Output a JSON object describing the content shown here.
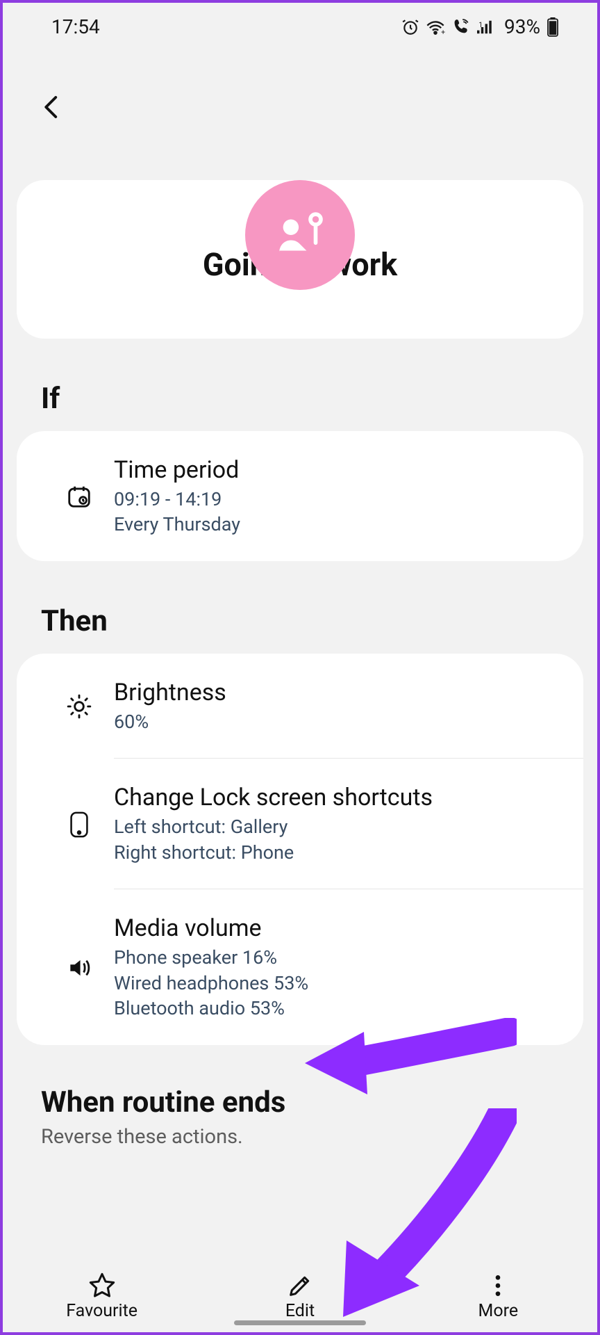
{
  "status": {
    "time": "17:54",
    "battery_text": "93%"
  },
  "routine": {
    "title": "Going to work"
  },
  "sections": {
    "if": {
      "header": "If",
      "time_period": {
        "title": "Time period",
        "range": "09:19 - 14:19",
        "repeat": "Every Thursday"
      }
    },
    "then": {
      "header": "Then",
      "brightness": {
        "title": "Brightness",
        "value": "60%"
      },
      "lock_shortcuts": {
        "title": "Change Lock screen shortcuts",
        "left": "Left shortcut: Gallery",
        "right": "Right shortcut: Phone"
      },
      "media_volume": {
        "title": "Media volume",
        "line1": "Phone speaker 16%",
        "line2": "Wired headphones 53%",
        "line3": "Bluetooth audio 53%"
      }
    },
    "end": {
      "header": "When routine ends",
      "sub": "Reverse these actions."
    }
  },
  "bottom": {
    "favourite": "Favourite",
    "edit": "Edit",
    "more": "More"
  }
}
